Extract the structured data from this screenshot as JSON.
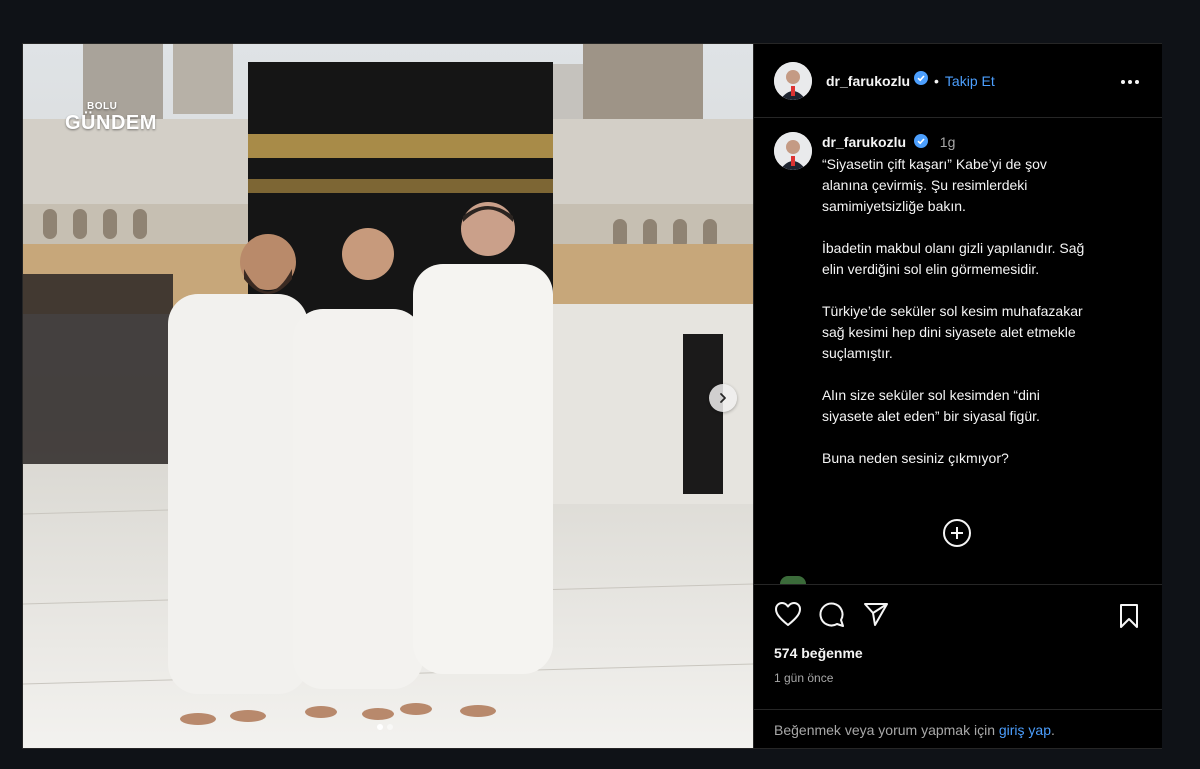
{
  "watermark": {
    "top": "BOLU",
    "bottom": "GÜNDEM"
  },
  "header": {
    "username": "dr_farukozlu",
    "separator": "•",
    "follow_label": "Takip Et",
    "more_icon": "more-horizontal-icon"
  },
  "caption": {
    "username": "dr_farukozlu",
    "time": "1g",
    "paragraphs": [
      "“Siyasetin çift kaşarı” Kabe’yi de şov\nalanına çevirmiş. Şu resimlerdeki\nsamimiyetsizliğe bakın.",
      "İbadetin makbul olanı gizli yapılanıdır. Sağ\nelin verdiğini sol elin görmemesidir.",
      "Türkiye’de seküler sol kesim muhafazakar\nsağ kesimi hep dini siyasete alet etmekle\nsuçlamıştır.",
      "Alın size seküler sol kesimden “dini\nsiyasete alet eden” bir siyasal figür.",
      "Buna neden sesiniz çıkmıyor?"
    ]
  },
  "carousel": {
    "total": 2,
    "active": 1,
    "next_icon": "chevron-right-icon"
  },
  "actions": {
    "icons": [
      "heart-icon",
      "comment-icon",
      "share-icon",
      "bookmark-icon"
    ],
    "likes": "574 beğenme",
    "time_ago": "1 gün önce"
  },
  "login_prompt": {
    "text": "Beğenmek veya yorum yapmak için ",
    "link": "giriş yap",
    "suffix": "."
  },
  "colors": {
    "accent": "#4c9ffe",
    "background": "#000000",
    "page": "#0f1217"
  }
}
